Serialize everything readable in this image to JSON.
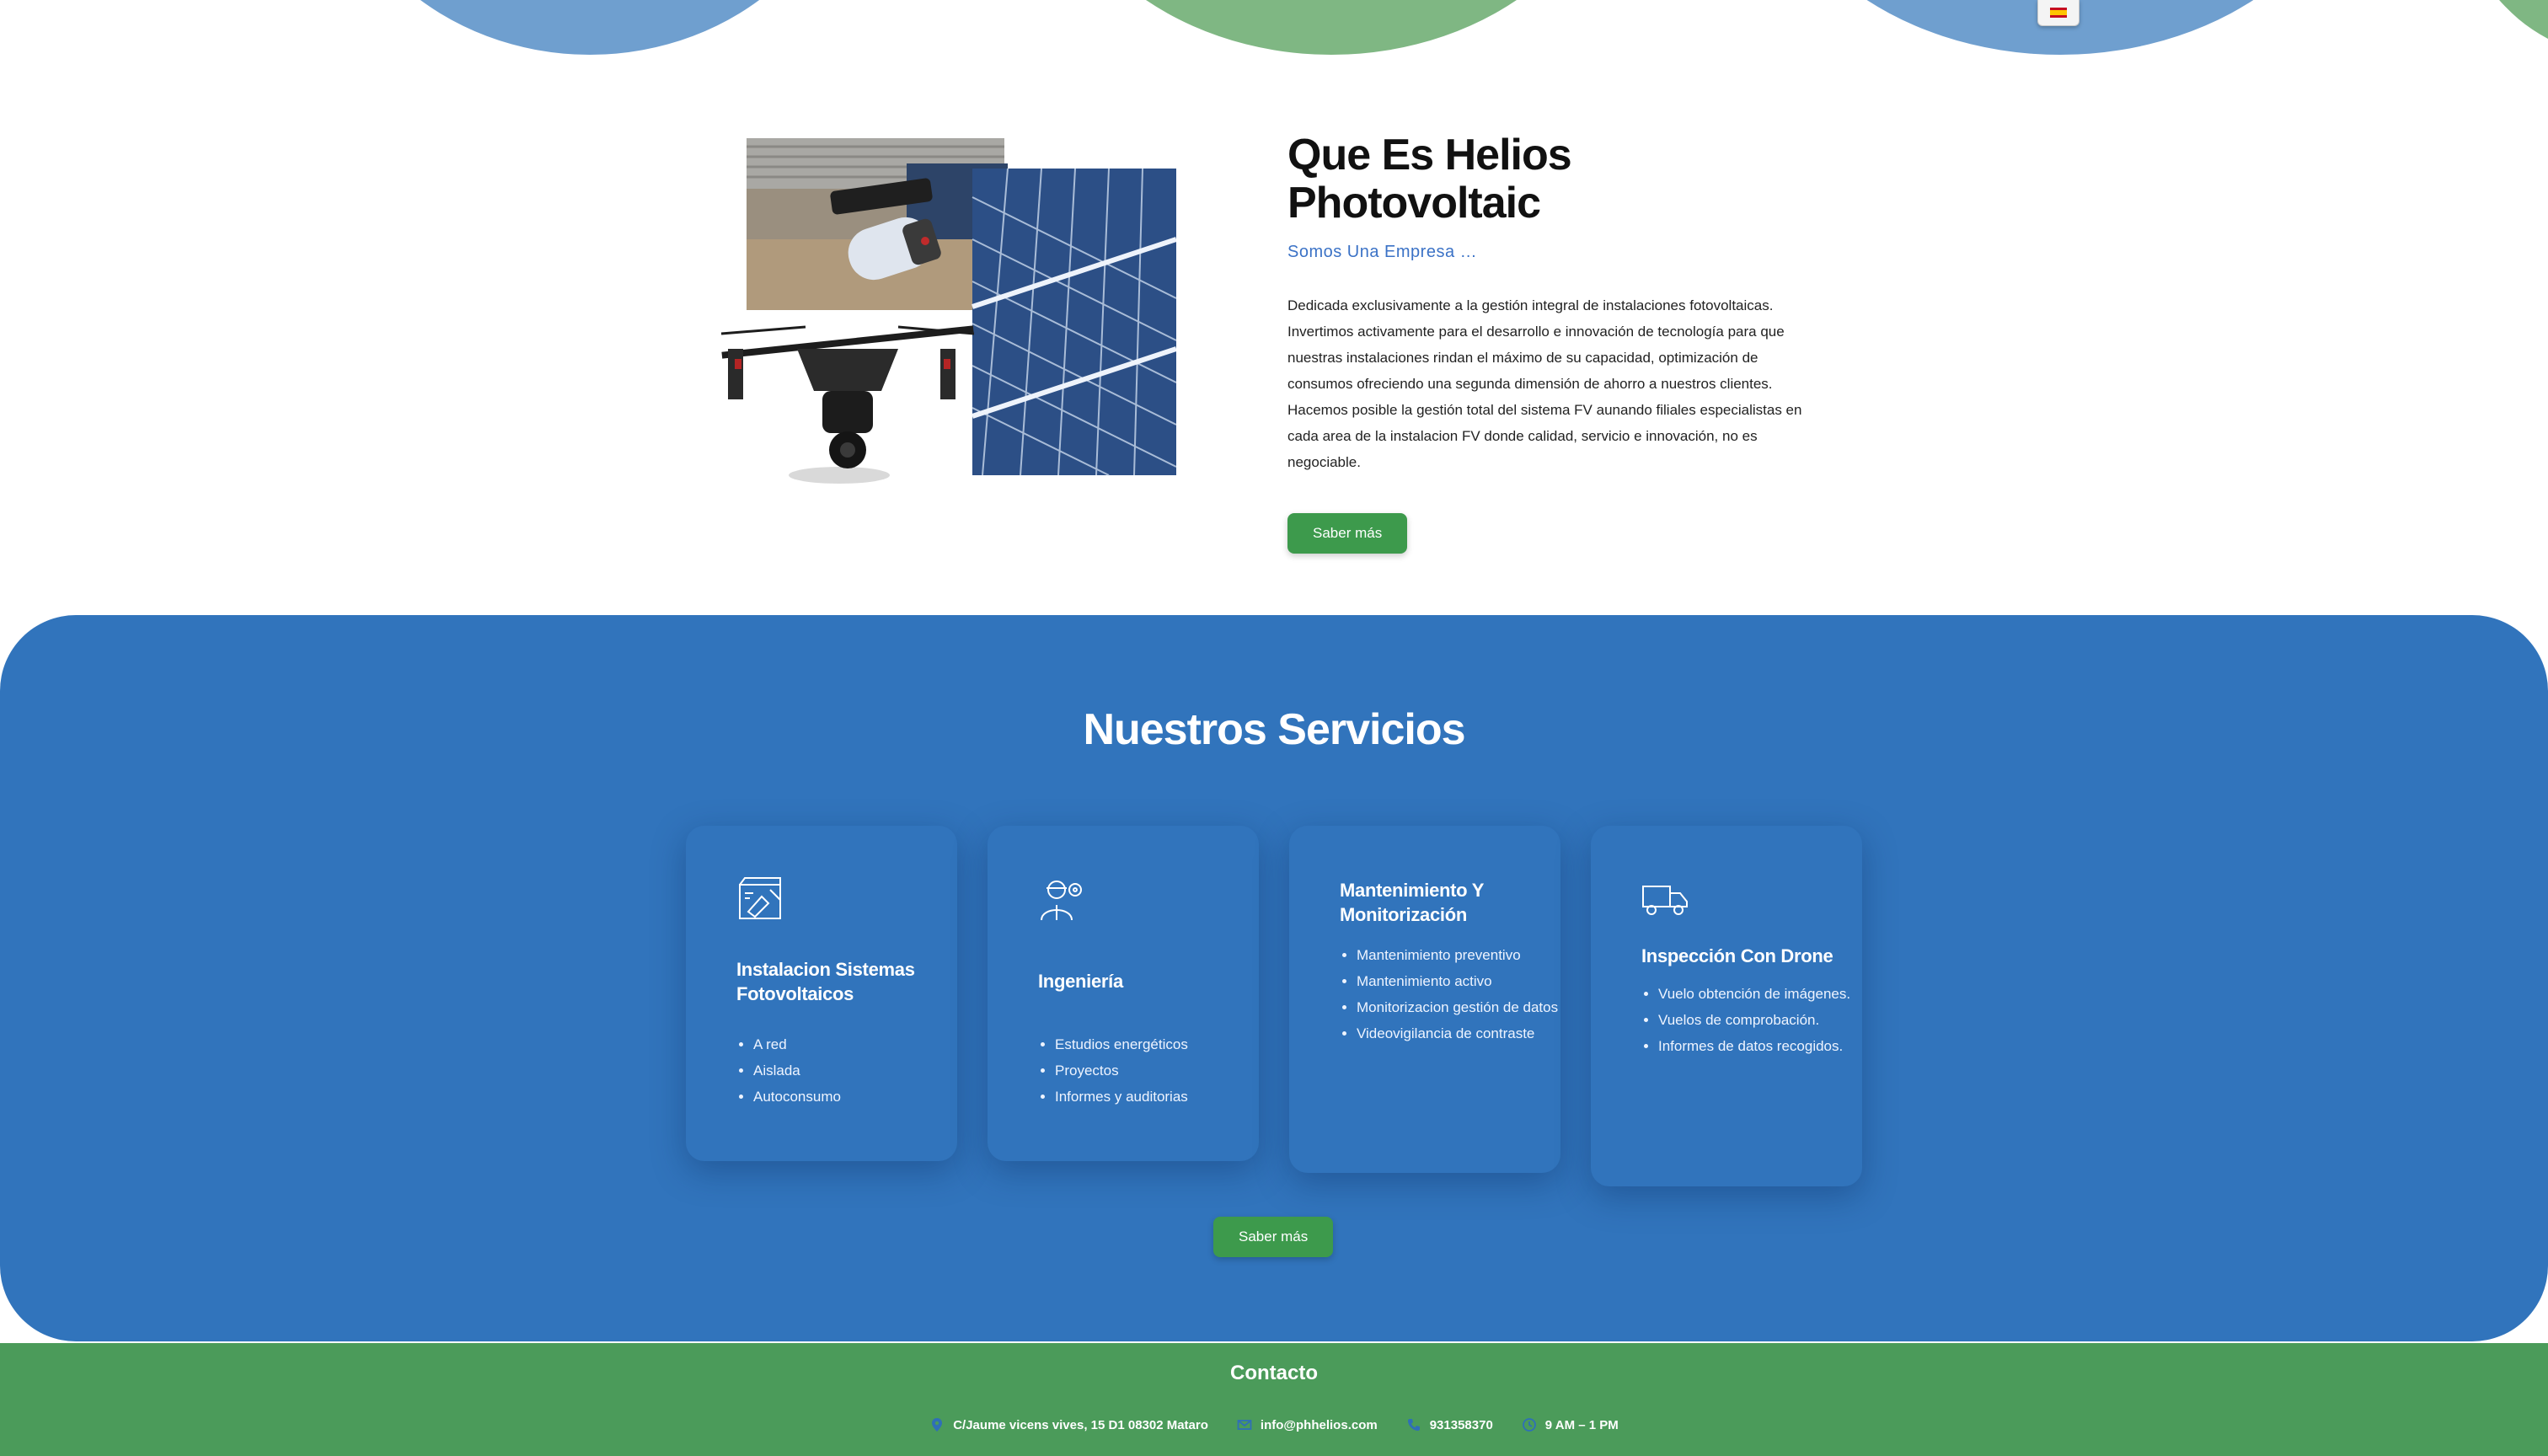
{
  "language": {
    "current": "es"
  },
  "about": {
    "title": "Que Es Helios Photovoltaic",
    "subtitle": "Somos Una Empresa …",
    "body": "Dedicada exclusivamente a la gestión integral de instalaciones fotovoltaicas. Invertimos activamente para el desarrollo e innovación de tecnología para que nuestras instalaciones rindan el máximo de su capacidad, optimización de consumos ofreciendo una segunda dimensión de ahorro a nuestros clientes. Hacemos posible la gestión total del sistema FV aunando filiales especialistas en cada area de la instalacion FV donde calidad, servicio e innovación, no es negociable.",
    "button": "Saber más"
  },
  "services": {
    "title": "Nuestros Servicios",
    "cards": [
      {
        "icon": "blueprint-icon",
        "title": "Instalacion Sistemas Fotovoltaicos",
        "items": [
          "A red",
          "Aislada",
          "Autoconsumo"
        ]
      },
      {
        "icon": "engineer-icon",
        "title": "Ingeniería",
        "items": [
          "Estudios energéticos",
          "Proyectos",
          "Informes y auditorias"
        ]
      },
      {
        "icon": "",
        "title": "Mantenimiento Y Monitorización",
        "items": [
          "Mantenimiento preventivo",
          "Mantenimiento activo",
          "Monitorizacion gestión de datos",
          "Videovigilancia de contraste"
        ]
      },
      {
        "icon": "truck-icon",
        "title": "Inspección Con Drone",
        "items": [
          "Vuelo obtención de imágenes.",
          "Vuelos de comprobación.",
          "Informes de datos recogidos."
        ]
      }
    ],
    "button": "Saber más"
  },
  "footer": {
    "title": "Contacto",
    "address": "C/Jaume vicens vives, 15 D1 08302 Mataro",
    "email": "info@phhelios.com",
    "phone": "931358370",
    "hours": "9 AM – 1 PM"
  },
  "colors": {
    "blue": "#3174bc",
    "green": "#3d9a4c",
    "footer_green": "#4b9b5a",
    "wave_blue": "#6f9fcf",
    "wave_green": "#7fb783"
  }
}
